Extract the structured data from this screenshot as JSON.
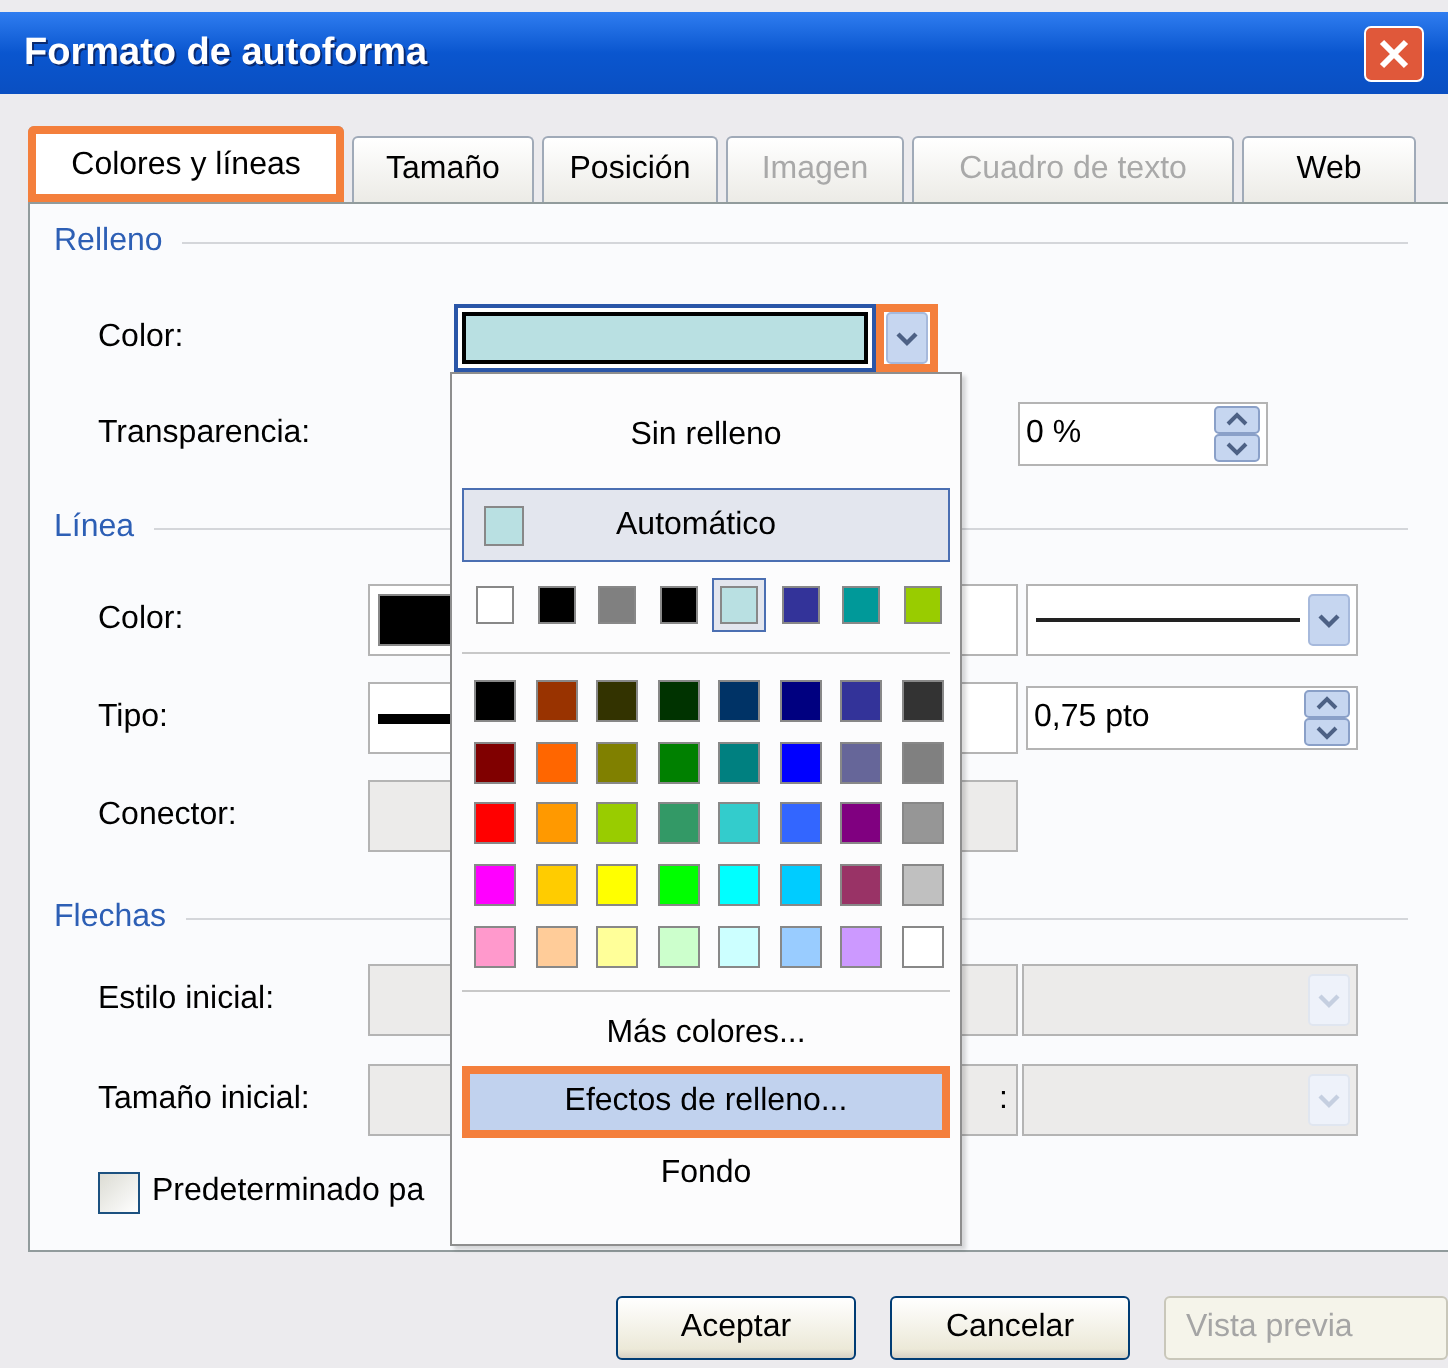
{
  "window": {
    "title": "Formato de autoforma"
  },
  "tabs": [
    {
      "label": "Colores y líneas",
      "selected": true,
      "disabled": false,
      "highlighted": true
    },
    {
      "label": "Tamaño",
      "selected": false,
      "disabled": false,
      "highlighted": false
    },
    {
      "label": "Posición",
      "selected": false,
      "disabled": false,
      "highlighted": false
    },
    {
      "label": "Imagen",
      "selected": false,
      "disabled": true,
      "highlighted": false
    },
    {
      "label": "Cuadro de texto",
      "selected": false,
      "disabled": true,
      "highlighted": false
    },
    {
      "label": "Web",
      "selected": false,
      "disabled": false,
      "highlighted": false
    }
  ],
  "fill": {
    "title": "Relleno",
    "color": {
      "label": "Color:",
      "color": "#b9e0e2",
      "highlighted": true
    },
    "transparency": {
      "label": "Transparencia:",
      "value": "0 %"
    }
  },
  "line": {
    "title": "Línea",
    "color": {
      "label": "Color:",
      "color": "#000000"
    },
    "type": {
      "label": "Tipo:",
      "value": "0,75 pto"
    },
    "connector": {
      "label": "Conector:",
      "disabled": true
    }
  },
  "arrows": {
    "title": "Flechas",
    "rows": [
      {
        "label": "Estilo inicial:",
        "disabled": true
      },
      {
        "label": "Tamaño inicial:",
        "disabled": true,
        "right_label": ":"
      }
    ],
    "default_checkbox": {
      "label": "Predeterminado pa",
      "checked": false
    }
  },
  "color_menu": {
    "no_fill": "Sin relleno",
    "automatic": {
      "label": "Automático",
      "color": "#b9e0e2",
      "selected": true
    },
    "recent": [
      {
        "color": "#ffffff",
        "selected": false
      },
      {
        "color": "#000000",
        "selected": false
      },
      {
        "color": "#808080",
        "selected": false
      },
      {
        "color": "#000000",
        "selected": false
      },
      {
        "color": "#b9e0e2",
        "selected": true
      },
      {
        "color": "#333399",
        "selected": false
      },
      {
        "color": "#009999",
        "selected": false
      },
      {
        "color": "#99cc00",
        "selected": false
      }
    ],
    "palette": [
      {
        "color": "#000000"
      },
      {
        "color": "#993300"
      },
      {
        "color": "#333300"
      },
      {
        "color": "#003300"
      },
      {
        "color": "#003366"
      },
      {
        "color": "#000080"
      },
      {
        "color": "#333399"
      },
      {
        "color": "#333333"
      },
      {
        "color": "#800000"
      },
      {
        "color": "#ff6600"
      },
      {
        "color": "#808000"
      },
      {
        "color": "#008000"
      },
      {
        "color": "#008080"
      },
      {
        "color": "#0000ff"
      },
      {
        "color": "#666699"
      },
      {
        "color": "#808080"
      },
      {
        "color": "#ff0000"
      },
      {
        "color": "#ff9900"
      },
      {
        "color": "#99cc00"
      },
      {
        "color": "#339966"
      },
      {
        "color": "#33cccc"
      },
      {
        "color": "#3366ff"
      },
      {
        "color": "#800080"
      },
      {
        "color": "#969696"
      },
      {
        "color": "#ff00ff"
      },
      {
        "color": "#ffcc00"
      },
      {
        "color": "#ffff00"
      },
      {
        "color": "#00ff00"
      },
      {
        "color": "#00ffff"
      },
      {
        "color": "#00ccff"
      },
      {
        "color": "#993366"
      },
      {
        "color": "#c0c0c0"
      },
      {
        "color": "#ff99cc"
      },
      {
        "color": "#ffcc99"
      },
      {
        "color": "#ffff99"
      },
      {
        "color": "#ccffcc"
      },
      {
        "color": "#ccffff"
      },
      {
        "color": "#99ccff"
      },
      {
        "color": "#cc99ff"
      },
      {
        "color": "#ffffff"
      }
    ],
    "items": [
      {
        "label": "Más colores...",
        "hovered": false,
        "highlighted": false
      },
      {
        "label": "Efectos de relleno...",
        "hovered": true,
        "highlighted": true
      },
      {
        "label": "Fondo",
        "hovered": false,
        "highlighted": false
      }
    ]
  },
  "buttons": [
    {
      "label": "Aceptar",
      "disabled": false
    },
    {
      "label": "Cancelar",
      "disabled": false
    },
    {
      "label": "Vista previa",
      "disabled": true
    }
  ]
}
